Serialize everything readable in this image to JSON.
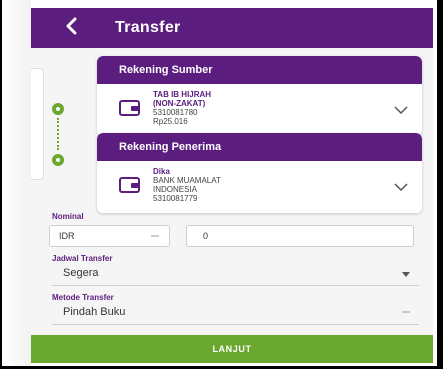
{
  "header": {
    "title": "Transfer"
  },
  "sumber": {
    "title": "Rekening Sumber",
    "lines": [
      "TAB IB HIJRAH",
      "(NON-ZAKAT)",
      "5310081780",
      "Rp25.016"
    ]
  },
  "penerima": {
    "title": "Rekening Penerima",
    "lines": [
      "Dika",
      "BANK MUAMALAT",
      "INDONESIA",
      "5310081779"
    ]
  },
  "form": {
    "nominal_label": "Nominal",
    "currency": "IDR",
    "amount": "0",
    "jadwal_label": "Jadwal Transfer",
    "jadwal_value": "Segera",
    "metode_label": "Metode Transfer",
    "metode_value": "Pindah Buku"
  },
  "button": {
    "label": "LANJUT"
  },
  "colors": {
    "primary": "#5b1d7e",
    "accent": "#6aa82f"
  }
}
